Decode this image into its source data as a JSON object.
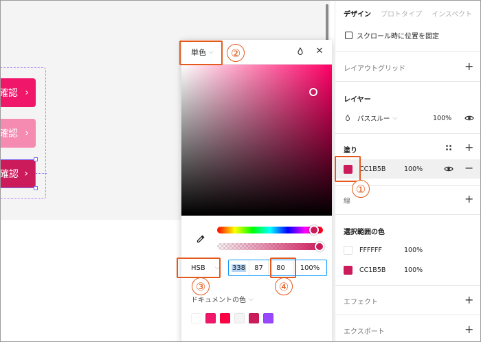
{
  "canvas": {
    "buttons": [
      {
        "label": "確認",
        "color": "#f0176b"
      },
      {
        "label": "確認",
        "color": "#f58bb0"
      },
      {
        "label": "確認",
        "color": "#cc1b5b"
      }
    ],
    "chevron": "›"
  },
  "picker": {
    "mode_label": "単色",
    "mode_chevron": "⌵",
    "close_glyph": "✕",
    "color_model": "HSB",
    "values": {
      "h": "338",
      "s": "87",
      "b": "80",
      "a": "100%"
    },
    "doc_colors_label": "ドキュメントの色",
    "swatches": [
      "#ffffff",
      "#f0176b",
      "#ff0044",
      "#f4f4f5",
      "#cc1b5b",
      "#9747ff"
    ],
    "current_color": "#cc1b5b"
  },
  "annotations": [
    "①",
    "②",
    "③",
    "④"
  ],
  "panel": {
    "tabs": [
      "デザイン",
      "プロトタイプ",
      "インスペクト"
    ],
    "active_tab": 0,
    "scroll_fix_label": "スクロール時に位置を固定",
    "layout_grid": "レイアウトグリッド",
    "layer": {
      "title": "レイヤー",
      "blend": "パススルー",
      "blend_chevron": "⌵",
      "opacity": "100%"
    },
    "fill": {
      "title": "塗り",
      "hex": "CC1B5B",
      "opacity": "100%",
      "color": "#cc1b5b"
    },
    "stroke": "線",
    "selection_colors": {
      "title": "選択範囲の色",
      "items": [
        {
          "hex": "FFFFFF",
          "opacity": "100%",
          "color": "#ffffff"
        },
        {
          "hex": "CC1B5B",
          "opacity": "100%",
          "color": "#cc1b5b"
        }
      ]
    },
    "effect": "エフェクト",
    "export": "エクスポート",
    "plus": "+",
    "minus": "−"
  },
  "accent": "#e35a1c"
}
